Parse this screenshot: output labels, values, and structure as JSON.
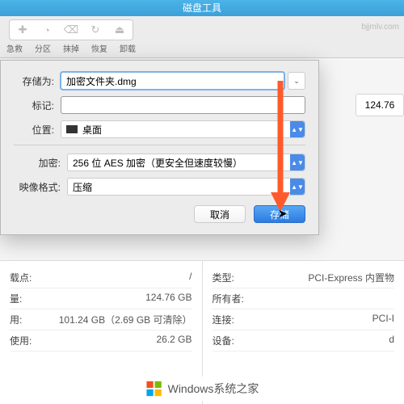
{
  "window_title": "磁盘工具",
  "watermark": "bjjmlv.com",
  "toolbar": {
    "group1": {
      "labels": [
        "急救",
        "分区",
        "抹掉",
        "恢复",
        "卸载"
      ]
    }
  },
  "sheet": {
    "save_as_label": "存储为:",
    "save_as_value": "加密文件夹.dmg",
    "tags_label": "标记:",
    "tags_value": "",
    "location_label": "位置:",
    "location_value": "桌面",
    "encryption_label": "加密:",
    "encryption_value": "256 位 AES 加密（更安全但速度较慢）",
    "format_label": "映像格式:",
    "format_value": "压缩",
    "cancel": "取消",
    "save": "存储"
  },
  "side_value": "124.76",
  "info_left": [
    {
      "k": "载点:",
      "v": "/"
    },
    {
      "k": "量:",
      "v": "124.76 GB"
    },
    {
      "k": "用:",
      "v": "101.24 GB（2.69 GB 可清除）"
    },
    {
      "k": "使用:",
      "v": "26.2 GB"
    }
  ],
  "info_right": [
    {
      "k": "类型:",
      "v": "PCI-Express 内置物"
    },
    {
      "k": "所有者:",
      "v": ""
    },
    {
      "k": "连接:",
      "v": "PCI-I"
    },
    {
      "k": "设备:",
      "v": "d"
    }
  ],
  "footer": "Windows系统之家"
}
